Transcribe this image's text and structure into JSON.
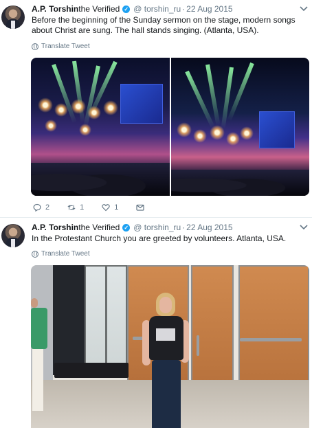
{
  "tweets": [
    {
      "author_name": "A.P. Torshin",
      "author_suffix": "the Verified",
      "handle": "@ torshin_ru",
      "separator": "·",
      "date": "22 Aug 2015",
      "text": "Before the beginning of the Sunday sermon on the stage, modern songs about Christ are sung. The hall stands singing. (Atlanta, USA).",
      "translate_label": "Translate Tweet",
      "media_description": "two concert photos",
      "actions": {
        "reply_count": "2",
        "retweet_count": "1",
        "like_count": "1"
      }
    },
    {
      "author_name": "A.P. Torshin",
      "author_suffix": "the Verified",
      "handle": "@ torshin_ru",
      "separator": "·",
      "date": "22 Aug 2015",
      "text": "In the Protestant Church you are greeted by volunteers. Atlanta, USA.",
      "translate_label": "Translate Tweet"
    }
  ],
  "colors": {
    "verified": "#1da1f2",
    "muted_text": "#657786",
    "primary_text": "#14171a"
  },
  "icons": [
    "verified-badge-icon",
    "chevron-down-icon",
    "globe-icon",
    "reply-icon",
    "retweet-icon",
    "like-icon",
    "direct-message-icon"
  ]
}
